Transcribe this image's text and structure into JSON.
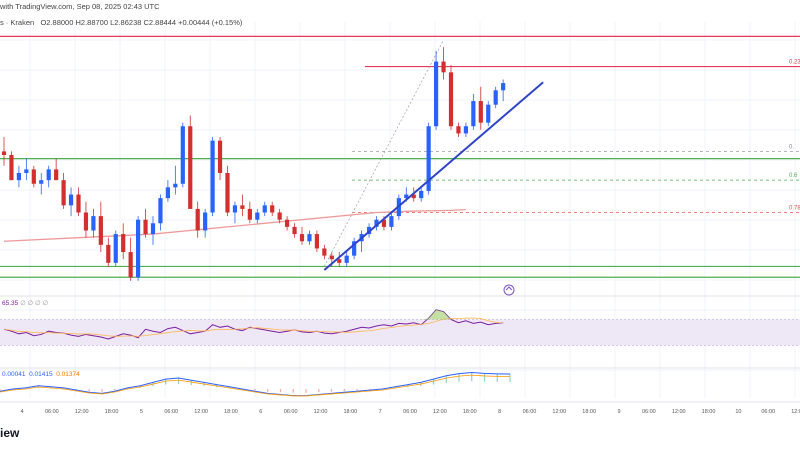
{
  "header": {
    "line1": "with TradingView.com, Sep 08, 2025 02:43 UTC",
    "pair_fragment": "s · Kraken",
    "ohlc_open": "O2.88000",
    "ohlc_high": "H2.88700",
    "ohlc_low": "L2.86238",
    "ohlc_close": "C2.88444",
    "change": "+0.00444 (+0.15%)"
  },
  "footer": {
    "logo_fragment": "iew"
  },
  "colors": {
    "up": "#2962ff",
    "down": "#d32f2f",
    "ma": "#ef9a9a",
    "support": "#4caf50",
    "resistance": "#e53958",
    "trendline": "#3044c8",
    "rsi_band": "#ede7f6",
    "rsi_line": "#7b1fa2"
  },
  "fib_labels": [
    "0.23",
    "0.",
    "0.6",
    "0.78"
  ],
  "rsi": {
    "legend_value": "65.35",
    "legend_dots": "∅ ∅ ∅ ∅"
  },
  "macd": {
    "legend_values": [
      "0.00041",
      "0.01415",
      "0.01374"
    ]
  },
  "chart_data": {
    "type": "candlestick",
    "title": "",
    "time_axis_labels": [
      "4",
      "06:00",
      "12:00",
      "18:00",
      "5",
      "06:00",
      "12:00",
      "18:00",
      "6",
      "06:00",
      "12:00",
      "18:00",
      "7",
      "06:00",
      "12:00",
      "18:00",
      "8",
      "06:00",
      "12:00",
      "18:00",
      "9",
      "06:00",
      "12:00",
      "18:00",
      "10",
      "06:00",
      "12:00"
    ],
    "price_range": [
      2.65,
      3.02
    ],
    "candles": [
      [
        2.84,
        2.86,
        2.82,
        2.835
      ],
      [
        2.835,
        2.84,
        2.8,
        2.8
      ],
      [
        2.8,
        2.82,
        2.79,
        2.81
      ],
      [
        2.81,
        2.83,
        2.8,
        2.815
      ],
      [
        2.815,
        2.82,
        2.79,
        2.795
      ],
      [
        2.795,
        2.81,
        2.78,
        2.8
      ],
      [
        2.8,
        2.82,
        2.79,
        2.815
      ],
      [
        2.815,
        2.83,
        2.8,
        2.8
      ],
      [
        2.8,
        2.81,
        2.76,
        2.765
      ],
      [
        2.765,
        2.79,
        2.75,
        2.78
      ],
      [
        2.78,
        2.79,
        2.75,
        2.755
      ],
      [
        2.755,
        2.77,
        2.72,
        2.73
      ],
      [
        2.73,
        2.76,
        2.72,
        2.75
      ],
      [
        2.75,
        2.77,
        2.7,
        2.71
      ],
      [
        2.71,
        2.72,
        2.68,
        2.685
      ],
      [
        2.685,
        2.73,
        2.68,
        2.725
      ],
      [
        2.725,
        2.74,
        2.69,
        2.7
      ],
      [
        2.7,
        2.72,
        2.66,
        2.665
      ],
      [
        2.665,
        2.75,
        2.66,
        2.745
      ],
      [
        2.745,
        2.76,
        2.72,
        2.725
      ],
      [
        2.725,
        2.75,
        2.71,
        2.74
      ],
      [
        2.74,
        2.78,
        2.73,
        2.775
      ],
      [
        2.775,
        2.8,
        2.77,
        2.79
      ],
      [
        2.79,
        2.82,
        2.78,
        2.795
      ],
      [
        2.795,
        2.88,
        2.79,
        2.875
      ],
      [
        2.875,
        2.89,
        2.76,
        2.76
      ],
      [
        2.76,
        2.77,
        2.72,
        2.73
      ],
      [
        2.73,
        2.76,
        2.72,
        2.755
      ],
      [
        2.755,
        2.86,
        2.75,
        2.855
      ],
      [
        2.855,
        2.86,
        2.8,
        2.81
      ],
      [
        2.81,
        2.82,
        2.75,
        2.755
      ],
      [
        2.755,
        2.77,
        2.74,
        2.765
      ],
      [
        2.765,
        2.78,
        2.75,
        2.76
      ],
      [
        2.76,
        2.77,
        2.74,
        2.745
      ],
      [
        2.745,
        2.76,
        2.74,
        2.755
      ],
      [
        2.755,
        2.77,
        2.75,
        2.765
      ],
      [
        2.765,
        2.77,
        2.75,
        2.755
      ],
      [
        2.755,
        2.76,
        2.74,
        2.745
      ],
      [
        2.745,
        2.75,
        2.73,
        2.735
      ],
      [
        2.735,
        2.74,
        2.72,
        2.725
      ],
      [
        2.725,
        2.735,
        2.71,
        2.715
      ],
      [
        2.715,
        2.73,
        2.71,
        2.725
      ],
      [
        2.725,
        2.73,
        2.7,
        2.705
      ],
      [
        2.705,
        2.71,
        2.69,
        2.695
      ],
      [
        2.695,
        2.7,
        2.68,
        2.69
      ],
      [
        2.69,
        2.7,
        2.68,
        2.685
      ],
      [
        2.685,
        2.7,
        2.68,
        2.695
      ],
      [
        2.695,
        2.72,
        2.69,
        2.715
      ],
      [
        2.715,
        2.73,
        2.7,
        2.725
      ],
      [
        2.725,
        2.74,
        2.72,
        2.735
      ],
      [
        2.735,
        2.75,
        2.73,
        2.745
      ],
      [
        2.745,
        2.75,
        2.73,
        2.735
      ],
      [
        2.735,
        2.755,
        2.73,
        2.75
      ],
      [
        2.75,
        2.78,
        2.745,
        2.775
      ],
      [
        2.775,
        2.79,
        2.77,
        2.78
      ],
      [
        2.78,
        2.79,
        2.77,
        2.775
      ],
      [
        2.775,
        2.79,
        2.77,
        2.785
      ],
      [
        2.785,
        2.88,
        2.78,
        2.875
      ],
      [
        2.875,
        2.98,
        2.87,
        2.965
      ],
      [
        2.965,
        2.985,
        2.94,
        2.95
      ],
      [
        2.95,
        2.96,
        2.87,
        2.875
      ],
      [
        2.875,
        2.88,
        2.86,
        2.865
      ],
      [
        2.865,
        2.88,
        2.86,
        2.875
      ],
      [
        2.875,
        2.92,
        2.87,
        2.91
      ],
      [
        2.91,
        2.93,
        2.87,
        2.88
      ],
      [
        2.88,
        2.91,
        2.875,
        2.905
      ],
      [
        2.905,
        2.93,
        2.9,
        2.925
      ],
      [
        2.925,
        2.94,
        2.91,
        2.935
      ]
    ],
    "moving_average": [
      [
        0,
        2.715
      ],
      [
        10,
        2.72
      ],
      [
        20,
        2.725
      ],
      [
        30,
        2.735
      ],
      [
        40,
        2.745
      ],
      [
        50,
        2.755
      ],
      [
        55,
        2.757
      ],
      [
        60,
        2.758
      ],
      [
        62,
        2.759
      ]
    ],
    "horizontal_levels": {
      "resistance": [
        3.0,
        2.958
      ],
      "support": [
        2.83,
        2.68,
        2.665
      ],
      "fib_dashed": [
        2.84,
        2.8,
        2.755
      ]
    },
    "trendline": {
      "from": [
        43,
        2.675
      ],
      "to": [
        67,
        2.925
      ]
    },
    "rsi": {
      "values": [
        55,
        52,
        48,
        50,
        45,
        47,
        52,
        50,
        49,
        46,
        44,
        47,
        45,
        43,
        40,
        44,
        48,
        46,
        42,
        55,
        52,
        50,
        56,
        58,
        53,
        48,
        50,
        52,
        62,
        58,
        60,
        55,
        53,
        58,
        56,
        54,
        52,
        50,
        52,
        54,
        51,
        50,
        52,
        49,
        48,
        50,
        52,
        55,
        58,
        57,
        60,
        62,
        60,
        64,
        63,
        65,
        62,
        72,
        85,
        82,
        70,
        65,
        68,
        64,
        66,
        62,
        64,
        65
      ]
    },
    "macd": {
      "values": [
        -0.002,
        0.0,
        0.001,
        0.003,
        0.002,
        0.001,
        -0.001,
        -0.003,
        -0.004,
        -0.002,
        0.001,
        0.003,
        0.006,
        0.009,
        0.01,
        0.008,
        0.006,
        0.004,
        0.002,
        0.0,
        -0.002,
        -0.004,
        -0.005,
        -0.006,
        -0.006,
        -0.005,
        -0.004,
        -0.003,
        -0.002,
        -0.001,
        0.0,
        0.002,
        0.004,
        0.006,
        0.009,
        0.012,
        0.014,
        0.015,
        0.0142,
        0.0138,
        0.0136
      ]
    }
  }
}
